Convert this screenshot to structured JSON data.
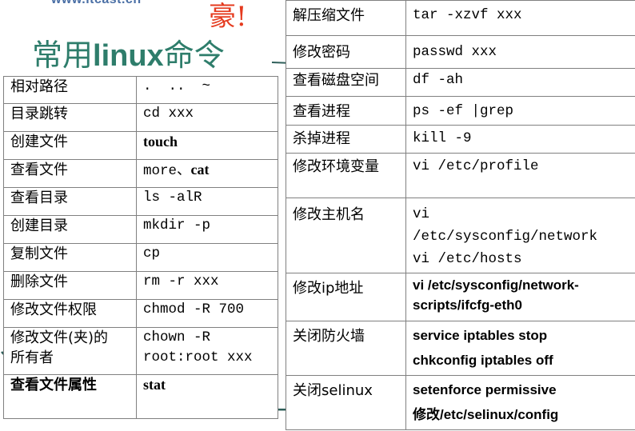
{
  "header": {
    "url_fragment": "www.itcast.cn",
    "accent_glyph": "豪!",
    "title_cn_prefix": "常用",
    "title_word": "linux",
    "title_cn_suffix": "命令"
  },
  "left_table": {
    "rows": [
      {
        "label": "相对路径",
        "command": ".  ..  ~"
      },
      {
        "label": "目录跳转",
        "command": "cd xxx"
      },
      {
        "label": "创建文件",
        "command": "touch"
      },
      {
        "label": "查看文件",
        "command_a": "more、",
        "command_b": "cat"
      },
      {
        "label": "查看目录",
        "command": "ls -alR"
      },
      {
        "label": "创建目录",
        "command": "mkdir -p"
      },
      {
        "label": "复制文件",
        "command": "cp"
      },
      {
        "label": "删除文件",
        "command": "rm -r xxx"
      },
      {
        "label": "修改文件权限",
        "command": "chmod -R 700"
      },
      {
        "label_line1": "修改文件(夹)的",
        "label_line2": "所有者",
        "command_line1": "chown -R",
        "command_line2": "root:root xxx"
      },
      {
        "label": "查看文件属性",
        "command": "stat"
      }
    ]
  },
  "right_table": {
    "rows": [
      {
        "label": "解压缩文件",
        "command": "tar -xzvf xxx"
      },
      {
        "label": "修改密码",
        "command": "passwd xxx"
      },
      {
        "label": "查看磁盘空间",
        "command": "df -ah"
      },
      {
        "label": "查看进程",
        "command": "ps -ef |grep"
      },
      {
        "label": "杀掉进程",
        "command": "kill -9"
      },
      {
        "label": "修改环境变量",
        "command": "vi /etc/profile"
      },
      {
        "label": "修改主机名",
        "command_line1": "vi",
        "command_line2": "/etc/sysconfig/network",
        "command_line3": "vi /etc/hosts"
      },
      {
        "label": "修改ip地址",
        "command_line1": "vi /etc/sysconfig/network-",
        "command_line2": "scripts/ifcfg-eth0"
      },
      {
        "label": "关闭防火墙",
        "command_line1": "service iptables stop",
        "command_line2": "chkconfig iptables off"
      },
      {
        "label": "关闭selinux",
        "command_line1": "setenforce permissive",
        "command_line2": "修改/etc/selinux/config"
      }
    ]
  },
  "colors": {
    "title": "#2e7d6b",
    "accent": "#e53a1e",
    "url": "#4a6fa5",
    "arc": "#2f5f5a",
    "grid": "#808080"
  }
}
